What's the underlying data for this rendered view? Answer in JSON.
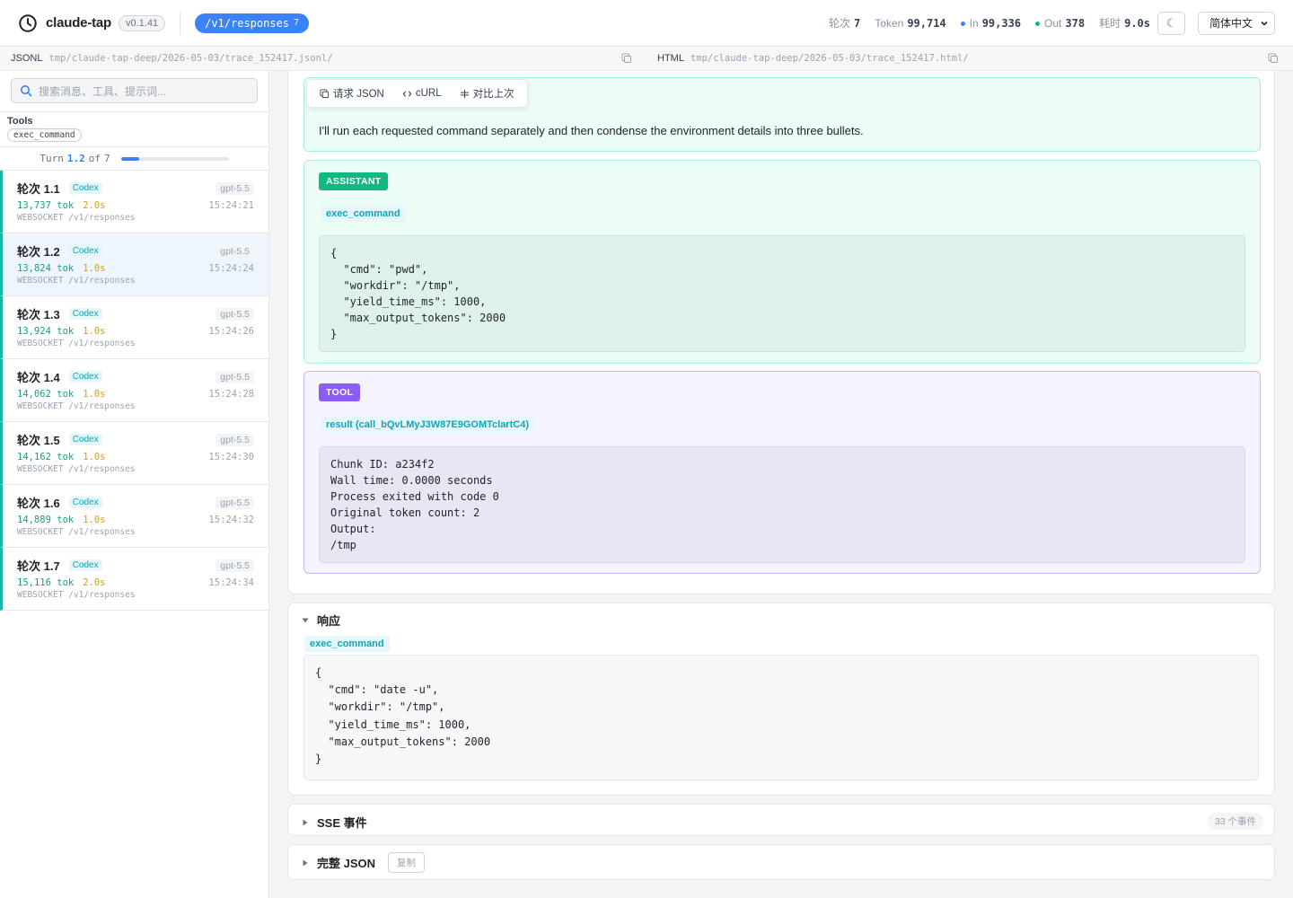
{
  "header": {
    "app_name": "claude-tap",
    "version": "v0.1.41",
    "endpoint": "/v1/responses",
    "endpoint_count": "7",
    "stats": {
      "turns_label": "轮次",
      "turns_value": "7",
      "token_label": "Token",
      "token_value": "99,714",
      "in_label": "In",
      "in_value": "99,336",
      "out_label": "Out",
      "out_value": "378",
      "time_label": "耗时",
      "time_value": "9.0s"
    },
    "theme_icon": "☾",
    "language": "简体中文"
  },
  "colors": {
    "accent": "#3b82f6",
    "assistant": "#10b981",
    "tool": "#8b5cf6",
    "codex": "#0ea5b7"
  },
  "pathbar": {
    "jsonl_label": "JSONL",
    "jsonl_path": "tmp/claude-tap-deep/2026-05-03/trace_152417.jsonl/",
    "html_label": "HTML",
    "html_path": "tmp/claude-tap-deep/2026-05-03/trace_152417.html/"
  },
  "sidebar": {
    "search_placeholder": "搜索消息、工具、提示词...",
    "tools_title": "Tools",
    "tools": [
      "exec_command"
    ],
    "turn_nav": {
      "label": "Turn",
      "current": "1.2",
      "of_label": "of",
      "total": "7",
      "progress": 0.17
    },
    "turns": [
      {
        "name": "轮次 1.1",
        "tag": "Codex",
        "model": "gpt-5.5",
        "tokens": "13,737 tok",
        "duration": "2.0s",
        "time": "15:24:21",
        "transport": "WEBSOCKET /v1/responses"
      },
      {
        "name": "轮次 1.2",
        "tag": "Codex",
        "model": "gpt-5.5",
        "tokens": "13,824 tok",
        "duration": "1.0s",
        "time": "15:24:24",
        "transport": "WEBSOCKET /v1/responses"
      },
      {
        "name": "轮次 1.3",
        "tag": "Codex",
        "model": "gpt-5.5",
        "tokens": "13,924 tok",
        "duration": "1.0s",
        "time": "15:24:26",
        "transport": "WEBSOCKET /v1/responses"
      },
      {
        "name": "轮次 1.4",
        "tag": "Codex",
        "model": "gpt-5.5",
        "tokens": "14,062 tok",
        "duration": "1.0s",
        "time": "15:24:28",
        "transport": "WEBSOCKET /v1/responses"
      },
      {
        "name": "轮次 1.5",
        "tag": "Codex",
        "model": "gpt-5.5",
        "tokens": "14,162 tok",
        "duration": "1.0s",
        "time": "15:24:30",
        "transport": "WEBSOCKET /v1/responses"
      },
      {
        "name": "轮次 1.6",
        "tag": "Codex",
        "model": "gpt-5.5",
        "tokens": "14,889 tok",
        "duration": "1.0s",
        "time": "15:24:32",
        "transport": "WEBSOCKET /v1/responses"
      },
      {
        "name": "轮次 1.7",
        "tag": "Codex",
        "model": "gpt-5.5",
        "tokens": "15,116 tok",
        "duration": "2.0s",
        "time": "15:24:34",
        "transport": "WEBSOCKET /v1/responses"
      }
    ]
  },
  "toolbar": {
    "copy_request": "请求 JSON",
    "curl": "cURL",
    "compare": "对比上次"
  },
  "messages": {
    "user_text": "I'll run each requested command separately and then condense the environment details into three bullets.",
    "assistant_role": "ASSISTANT",
    "assistant_fn": "exec_command",
    "assistant_code": "{\n  \"cmd\": \"pwd\",\n  \"workdir\": \"/tmp\",\n  \"yield_time_ms\": 1000,\n  \"max_output_tokens\": 2000\n}",
    "tool_role": "TOOL",
    "tool_fn": "result (call_bQvLMyJ3W87E9GOMTclartC4)",
    "tool_code": "Chunk ID: a234f2\nWall time: 0.0000 seconds\nProcess exited with code 0\nOriginal token count: 2\nOutput:\n/tmp"
  },
  "response": {
    "title": "响应",
    "fn": "exec_command",
    "code": "{\n  \"cmd\": \"date -u\",\n  \"workdir\": \"/tmp\",\n  \"yield_time_ms\": 1000,\n  \"max_output_tokens\": 2000\n}"
  },
  "sse": {
    "title": "SSE 事件",
    "count": "33 个事件"
  },
  "full_json": {
    "title": "完整 JSON",
    "copy": "复制"
  }
}
